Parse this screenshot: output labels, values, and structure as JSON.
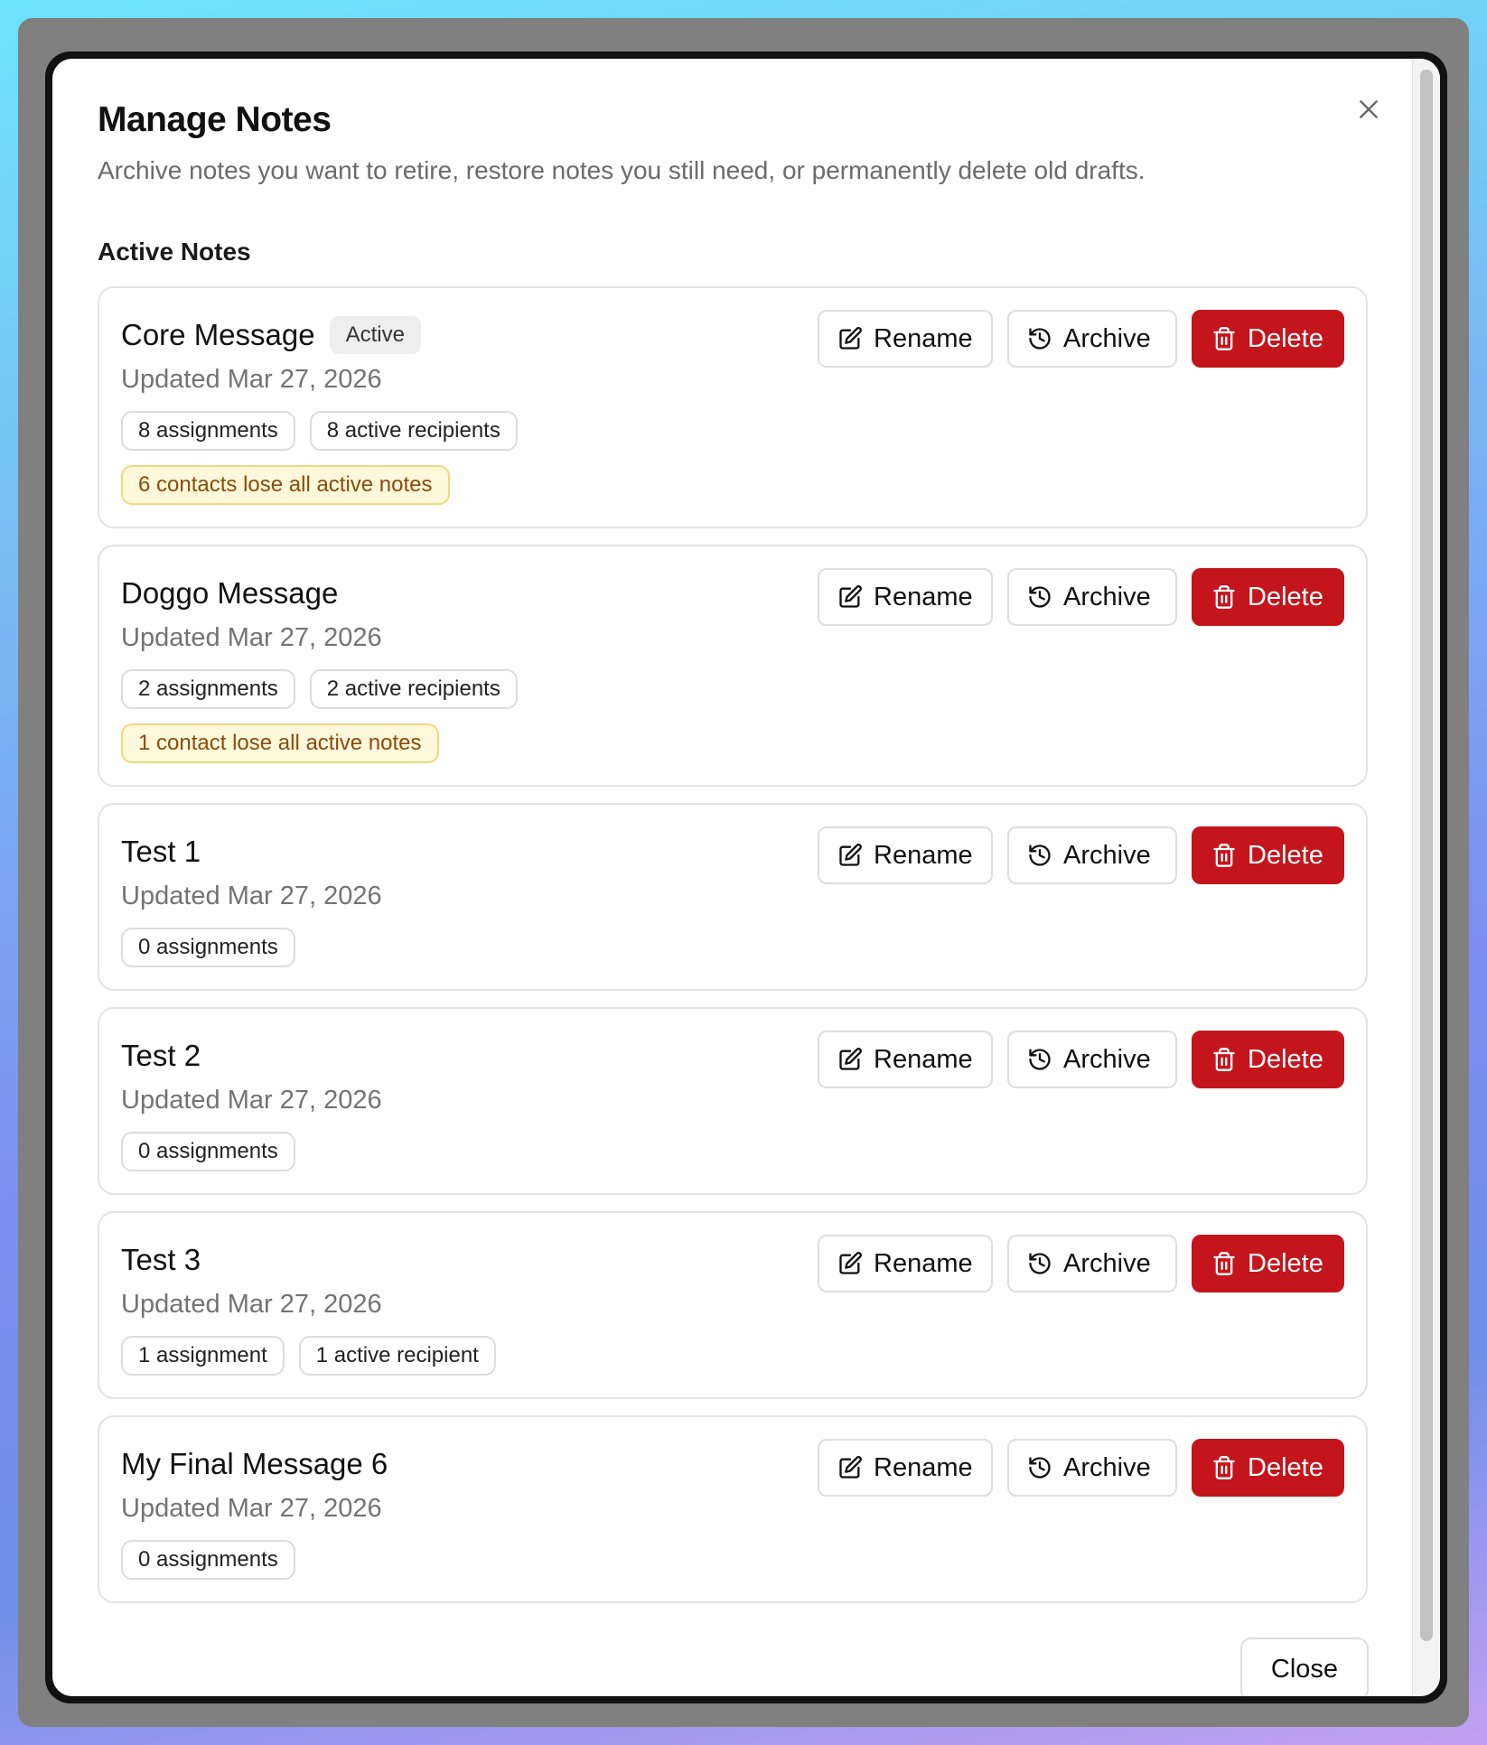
{
  "dialog": {
    "title": "Manage Notes",
    "subtitle": "Archive notes you want to retire, restore notes you still need, or permanently delete old drafts.",
    "section_title": "Active Notes",
    "close_label": "Close"
  },
  "actions": {
    "rename": "Rename",
    "archive": "Archive",
    "delete": "Delete"
  },
  "icons": {
    "close": "close-icon",
    "rename": "edit-icon",
    "archive": "history-icon",
    "delete": "trash-icon"
  },
  "colors": {
    "delete": "#c4151c",
    "warning_bg": "#fff8db",
    "warning_text": "#8a4b0c"
  },
  "notes": [
    {
      "name": "Core Message",
      "badge": "Active",
      "updated": "Updated Mar 27, 2026",
      "tags": [
        "8 assignments",
        "8 active recipients"
      ],
      "warning": "6 contacts lose all active notes"
    },
    {
      "name": "Doggo Message",
      "badge": "",
      "updated": "Updated Mar 27, 2026",
      "tags": [
        "2 assignments",
        "2 active recipients"
      ],
      "warning": "1 contact lose all active notes"
    },
    {
      "name": "Test 1",
      "badge": "",
      "updated": "Updated Mar 27, 2026",
      "tags": [
        "0 assignments"
      ],
      "warning": ""
    },
    {
      "name": "Test 2",
      "badge": "",
      "updated": "Updated Mar 27, 2026",
      "tags": [
        "0 assignments"
      ],
      "warning": ""
    },
    {
      "name": "Test 3",
      "badge": "",
      "updated": "Updated Mar 27, 2026",
      "tags": [
        "1 assignment",
        "1 active recipient"
      ],
      "warning": ""
    },
    {
      "name": "My Final Message 6",
      "badge": "",
      "updated": "Updated Mar 27, 2026",
      "tags": [
        "0 assignments"
      ],
      "warning": ""
    }
  ]
}
